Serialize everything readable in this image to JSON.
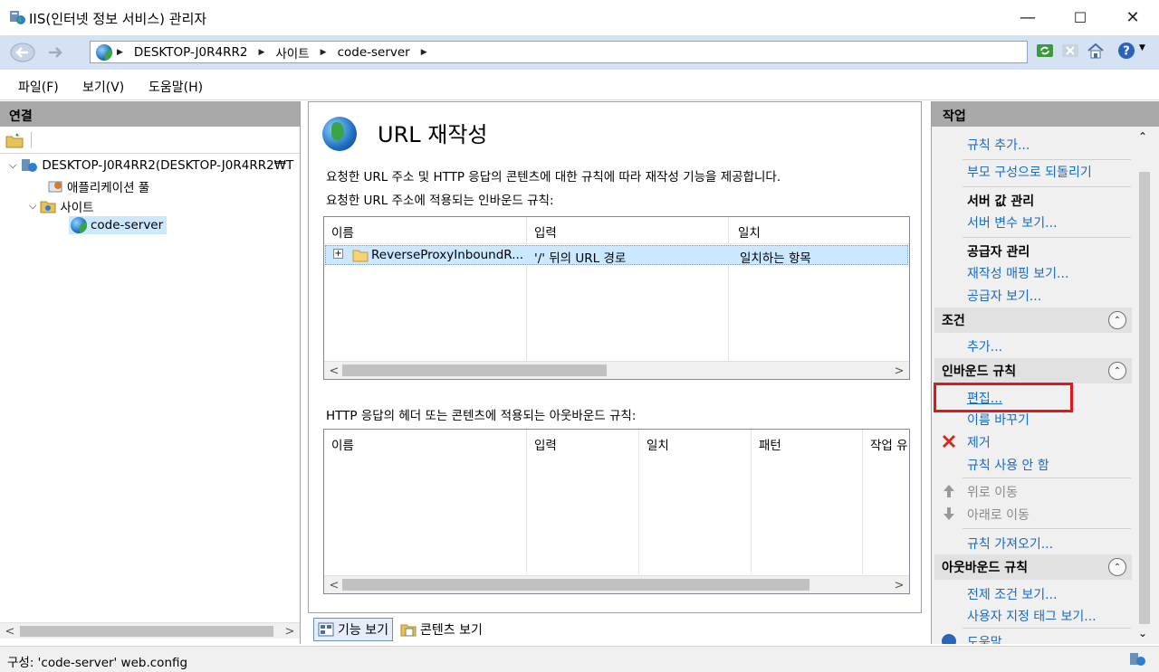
{
  "window": {
    "title": "IIS(인터넷 정보 서비스) 관리자",
    "minimize": "—",
    "maximize": "☐",
    "close": "✕"
  },
  "address": {
    "segments": [
      "DESKTOP-J0R4RR2",
      "사이트",
      "code-server"
    ]
  },
  "menu": {
    "items": [
      "파일(F)",
      "보기(V)",
      "도움말(H)"
    ]
  },
  "connections": {
    "title": "연결",
    "tree": {
      "server": "DESKTOP-J0R4RR2(DESKTOP-J0R4RR2₩T",
      "app_pools": "애플리케이션 풀",
      "sites": "사이트",
      "site": "code-server"
    }
  },
  "feature": {
    "title": "URL 재작성",
    "description": "요청한 URL 주소 및 HTTP 응답의 콘텐츠에 대한 규칙에 따라 재작성 기능을 제공합니다.",
    "inbound_label": "요청한 URL 주소에 적용되는 인바운드 규칙:",
    "inbound_columns": [
      "이름",
      "입력",
      "일치"
    ],
    "inbound_rows": [
      {
        "name": "ReverseProxyInboundR...",
        "input": "'/' 뒤의 URL 경로",
        "match": "일치하는 항목"
      }
    ],
    "outbound_label": "HTTP 응답의 헤더 또는 콘텐츠에 적용되는 아웃바운드 규칙:",
    "outbound_columns": [
      "이름",
      "입력",
      "일치",
      "패턴",
      "작업 유"
    ]
  },
  "view_tabs": {
    "features": "기능 보기",
    "content": "콘텐츠 보기"
  },
  "actions": {
    "title": "작업",
    "add_rule": "규칙 추가...",
    "revert_parent": "부모 구성으로 되돌리기",
    "server_vars_head": "서버 값 관리",
    "view_server_vars": "서버 변수 보기...",
    "providers_head": "공급자 관리",
    "view_maps": "재작성 매핑 보기...",
    "view_providers": "공급자 보기...",
    "conditions_head": "조건",
    "cond_add": "추가...",
    "inbound_head": "인바운드 규칙",
    "edit": "편집...",
    "rename": "이름 바꾸기",
    "remove": "제거",
    "disable": "규칙 사용 안 함",
    "move_up": "위로 이동",
    "move_down": "아래로 이동",
    "import": "규칙 가져오기...",
    "outbound_head": "아웃바운드 규칙",
    "view_preconditions": "전제 조건 보기...",
    "view_custom_tags": "사용자 지정 태그 보기...",
    "help": "도움말"
  },
  "status": {
    "text": "구성: 'code-server' web.config"
  },
  "colors": {
    "accent_link": "#1a6ac2",
    "highlight_box": "#e0161b",
    "selected_row": "#cce8ff"
  }
}
